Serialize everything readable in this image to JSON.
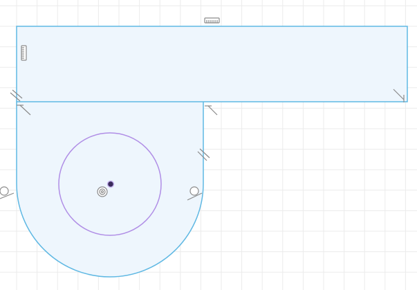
{
  "sketch": {
    "grid": true,
    "colors": {
      "background": "#ffffff",
      "grid_minor": "#ebebeb",
      "grid_major": "#d9d9d9",
      "profile_fill": "#eef6fd",
      "profile_stroke": "#5fb8e3",
      "construction_circle": "#b08ee6",
      "center_point": "#3a2b5c",
      "constraint_glyph": "#8a8a8a"
    },
    "constraint_icons": [
      "horizontal-constraint-icon",
      "vertical-constraint-icon",
      "parallel-constraint-icon",
      "perpendicular-constraint-icon",
      "tangent-constraint-icon",
      "concentric-constraint-icon"
    ]
  }
}
